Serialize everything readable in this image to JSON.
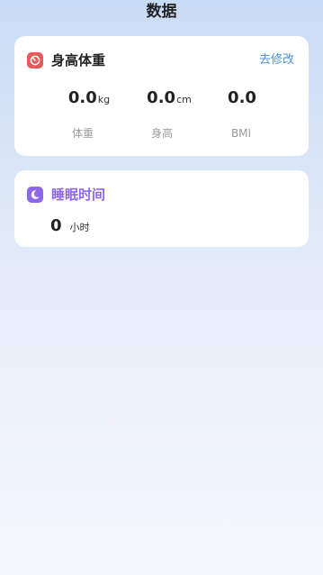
{
  "header": {
    "title": "数据"
  },
  "body_metrics": {
    "title": "身高体重",
    "edit_label": "去修改",
    "icon": "scale-icon",
    "accent": "#e8595a",
    "items": [
      {
        "value": "0.0",
        "unit": "kg",
        "label": "体重"
      },
      {
        "value": "0.0",
        "unit": "cm",
        "label": "身高"
      },
      {
        "value": "0.0",
        "unit": "",
        "label": "BMI"
      }
    ]
  },
  "sleep": {
    "title": "睡眠时间",
    "icon": "moon-icon",
    "accent": "#8d67e8",
    "value": "0",
    "unit": "小时"
  }
}
